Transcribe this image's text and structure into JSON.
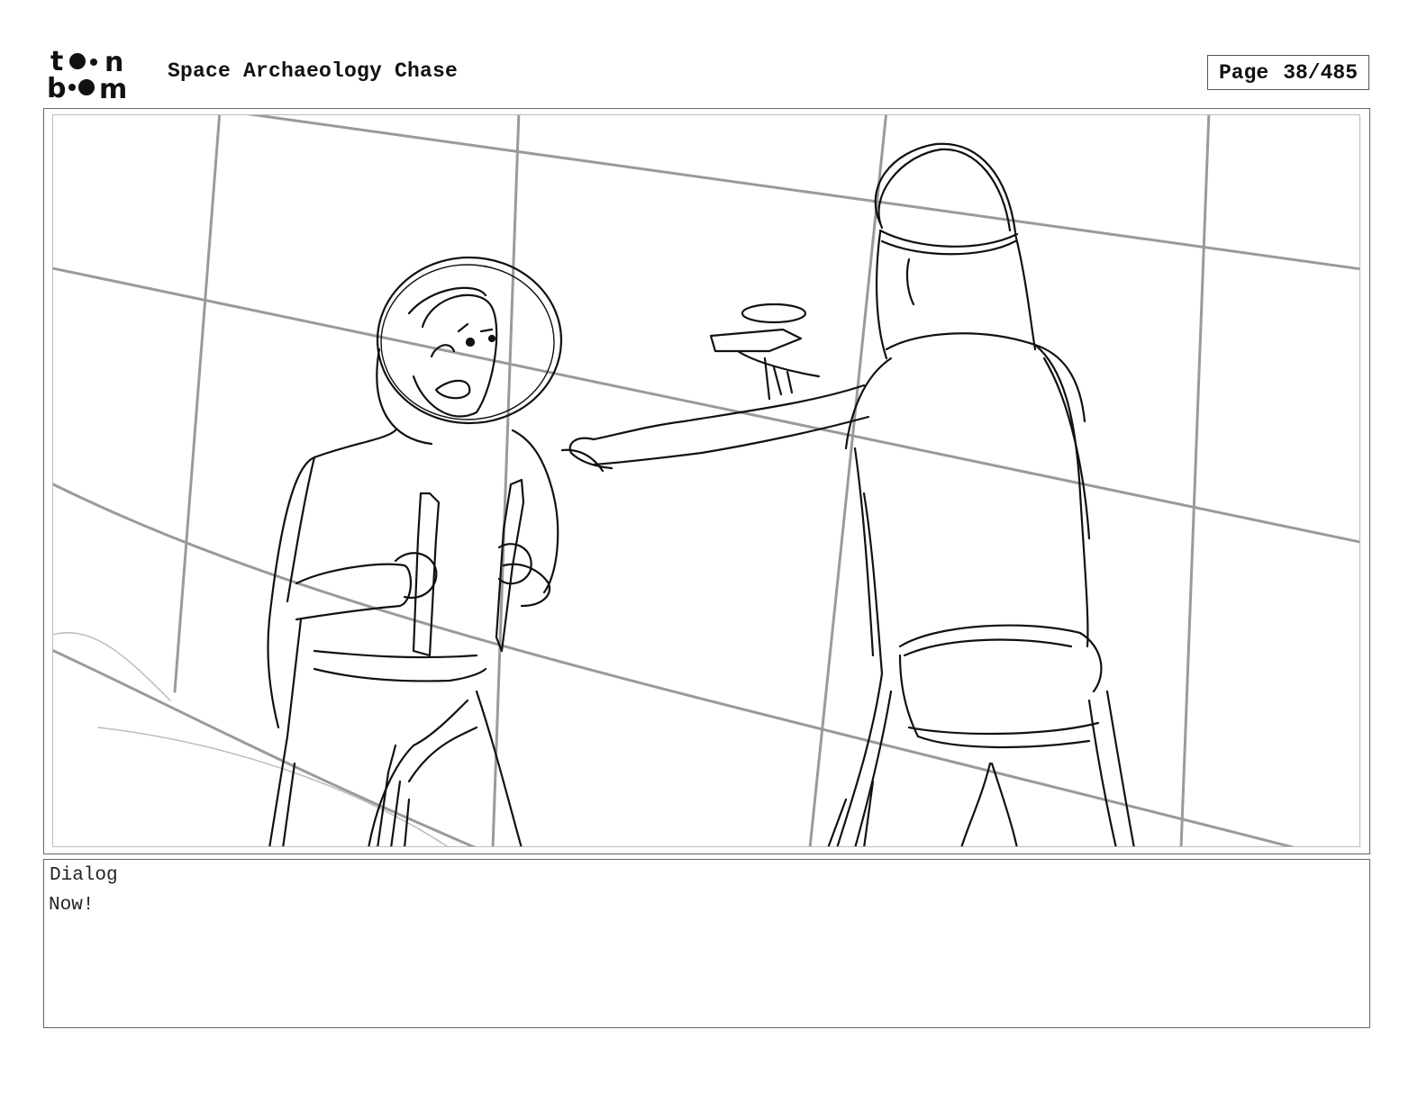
{
  "header": {
    "logo_icon": "toon-boom-logo",
    "logo_text": "toon boom",
    "project_title": "Space Archaeology Chase",
    "page_label": "Page",
    "page_number": "38/485"
  },
  "panel": {
    "image": "storyboard-sketch-two-astronauts"
  },
  "dialog": {
    "label": "Dialog",
    "text": "Now!"
  }
}
